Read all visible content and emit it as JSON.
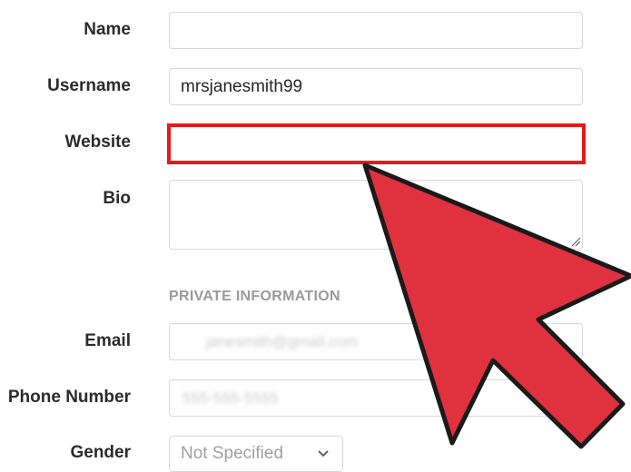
{
  "form": {
    "name": {
      "label": "Name",
      "value": "",
      "placeholder": ""
    },
    "username": {
      "label": "Username",
      "value": "mrsjanesmith99"
    },
    "website": {
      "label": "Website",
      "value": "",
      "highlight_color": "#e61919"
    },
    "bio": {
      "label": "Bio",
      "value": ""
    }
  },
  "private": {
    "heading": "PRIVATE INFORMATION",
    "email": {
      "label": "Email",
      "blurred_value": "janesmith@gmail.com"
    },
    "phone": {
      "label": "Phone Number",
      "blurred_value": "555-555-5555"
    },
    "gender": {
      "label": "Gender",
      "selected": "Not Specified"
    }
  },
  "overlay": {
    "arrow_icon": "large-red-pointer-arrow",
    "arrow_color": "#e0313f"
  }
}
